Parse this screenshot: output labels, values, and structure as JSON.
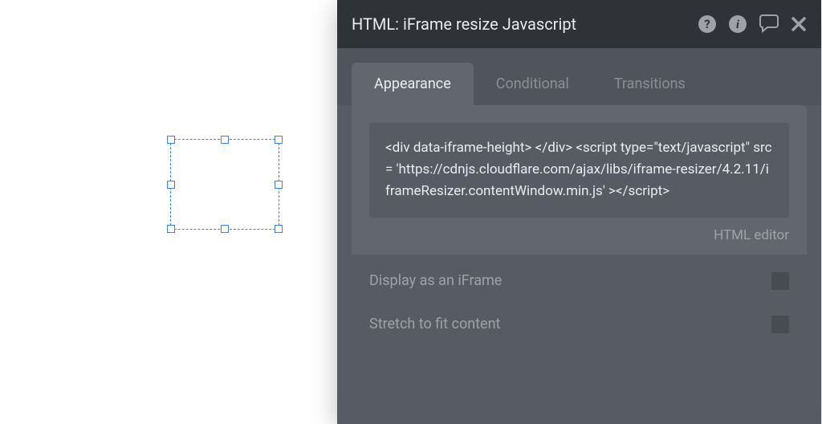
{
  "panel": {
    "title": "HTML: iFrame resize Javascript"
  },
  "tabs": {
    "appearance": "Appearance",
    "conditional": "Conditional",
    "transitions": "Transitions"
  },
  "appearance": {
    "code_content": "<div data-iframe-height>   </div> <script type=\"text/javascript\" src = 'https://cdnjs.cloudflare.com/ajax/libs/iframe-resizer/4.2.11/iframeResizer.contentWindow.min.js' ></script>",
    "html_editor_label": "HTML editor"
  },
  "options": {
    "display_as_iframe": "Display as an iFrame",
    "stretch_to_fit": "Stretch to fit content"
  }
}
